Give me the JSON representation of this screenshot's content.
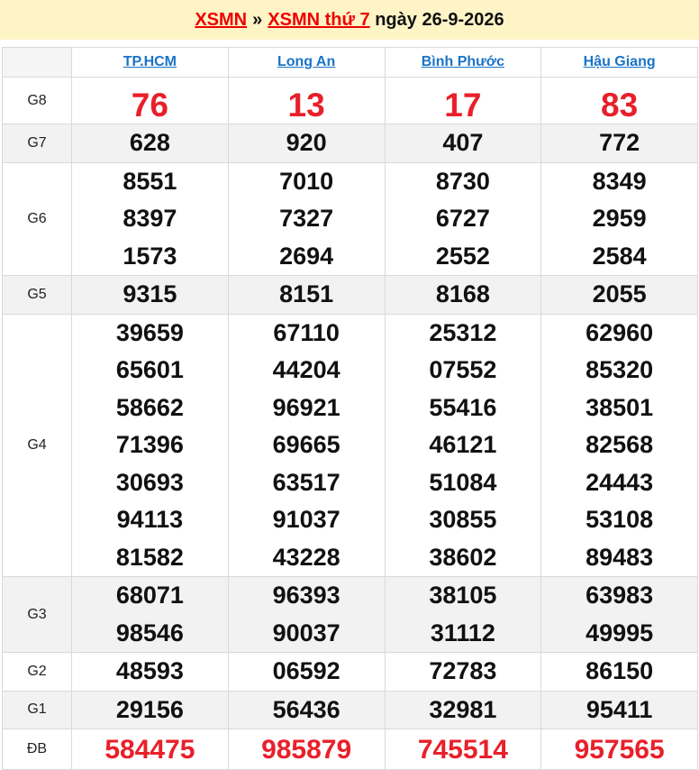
{
  "header": {
    "link1": "XSMN",
    "separator": "»",
    "link2": "XSMN thứ 7",
    "date_text": "ngày 26-9-2026"
  },
  "provinces": [
    "TP.HCM",
    "Long An",
    "Bình Phước",
    "Hậu Giang"
  ],
  "prizes": [
    {
      "label": "G8",
      "values": [
        [
          "76"
        ],
        [
          "13"
        ],
        [
          "17"
        ],
        [
          "83"
        ]
      ]
    },
    {
      "label": "G7",
      "values": [
        [
          "628"
        ],
        [
          "920"
        ],
        [
          "407"
        ],
        [
          "772"
        ]
      ]
    },
    {
      "label": "G6",
      "values": [
        [
          "8551",
          "8397",
          "1573"
        ],
        [
          "7010",
          "7327",
          "2694"
        ],
        [
          "8730",
          "6727",
          "2552"
        ],
        [
          "8349",
          "2959",
          "2584"
        ]
      ]
    },
    {
      "label": "G5",
      "values": [
        [
          "9315"
        ],
        [
          "8151"
        ],
        [
          "8168"
        ],
        [
          "2055"
        ]
      ]
    },
    {
      "label": "G4",
      "values": [
        [
          "39659",
          "65601",
          "58662",
          "71396",
          "30693",
          "94113",
          "81582"
        ],
        [
          "67110",
          "44204",
          "96921",
          "69665",
          "63517",
          "91037",
          "43228"
        ],
        [
          "25312",
          "07552",
          "55416",
          "46121",
          "51084",
          "30855",
          "38602"
        ],
        [
          "62960",
          "85320",
          "38501",
          "82568",
          "24443",
          "53108",
          "89483"
        ]
      ]
    },
    {
      "label": "G3",
      "values": [
        [
          "68071",
          "98546"
        ],
        [
          "96393",
          "90037"
        ],
        [
          "38105",
          "31112"
        ],
        [
          "63983",
          "49995"
        ]
      ]
    },
    {
      "label": "G2",
      "values": [
        [
          "48593"
        ],
        [
          "06592"
        ],
        [
          "72783"
        ],
        [
          "86150"
        ]
      ]
    },
    {
      "label": "G1",
      "values": [
        [
          "29156"
        ],
        [
          "56436"
        ],
        [
          "32981"
        ],
        [
          "95411"
        ]
      ]
    },
    {
      "label": "ĐB",
      "values": [
        [
          "584475"
        ],
        [
          "985879"
        ],
        [
          "745514"
        ],
        [
          "957565"
        ]
      ]
    }
  ],
  "colors": {
    "header_bg": "#fff4c6",
    "link_red": "#ee0000",
    "province_link": "#1a73c7",
    "special_number": "#e8202a",
    "alt_row": "#f2f2f2"
  }
}
